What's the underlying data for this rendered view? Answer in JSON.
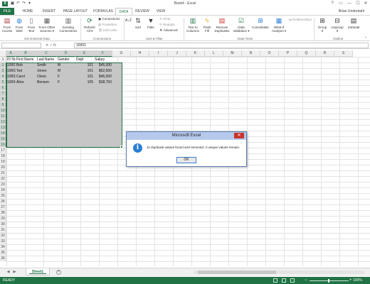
{
  "titlebar": {
    "app_title": "Book4 - Excel",
    "logo_text": "X",
    "help": "?",
    "ribbon_options": "▭",
    "minimize": "—",
    "maximize": "☐",
    "close": "✕"
  },
  "tabs": {
    "file": "FILE",
    "items": [
      "HOME",
      "INSERT",
      "PAGE LAYOUT",
      "FORMULAS",
      "DATA",
      "REVIEW",
      "VIEW"
    ],
    "active": "DATA",
    "user": "Brian Underdahl"
  },
  "ribbon": {
    "get_external_data": {
      "from_access": "From\nAccess",
      "from_web": "From\nWeb",
      "from_text": "From\nText",
      "from_other_sources": "From Other\nSources ▾",
      "existing_connections": "Existing\nConnections",
      "label": "Get External Data"
    },
    "connections": {
      "refresh_all": "Refresh\nAll ▾",
      "connections": "Connections",
      "properties": "Properties",
      "edit_links": "Edit Links",
      "label": "Connections"
    },
    "sort_filter": {
      "sort": "Sort",
      "filter": "Filter",
      "clear": "Clear",
      "reapply": "Reapply",
      "advanced": "Advanced",
      "label": "Sort & Filter"
    },
    "data_tools": {
      "text_to_columns": "Text to\nColumns",
      "flash_fill": "Flash\nFill",
      "remove_duplicates": "Remove\nDuplicates",
      "data_validation": "Data\nValidation ▾",
      "consolidate": "Consolidate",
      "what_if": "What-If\nAnalysis ▾",
      "relationships": "Relationships",
      "label": "Data Tools"
    },
    "outline": {
      "group": "Group\n▾",
      "ungroup": "Ungroup\n▾",
      "subtotal": "Subtotal",
      "label": "Outline"
    }
  },
  "formula_bar": {
    "fx": "✕  ✓  fx",
    "value": "10001"
  },
  "columns": [
    "A",
    "B",
    "C",
    "D",
    "E",
    "F",
    "G",
    "H",
    "I",
    "J",
    "K",
    "L",
    "M",
    "N",
    "O",
    "P",
    "Q",
    "R",
    "S"
  ],
  "rows": [
    "1",
    "2",
    "3",
    "4",
    "5",
    "6",
    "7",
    "8",
    "9",
    "10",
    "11",
    "12",
    "13",
    "14",
    "15",
    "16",
    "17",
    "18",
    "19",
    "20",
    "21",
    "22",
    "23",
    "24",
    "25",
    "26",
    "27",
    "28",
    "29",
    "30",
    "31",
    "32",
    "33",
    "34",
    "35",
    "36"
  ],
  "table": {
    "headers": [
      "ID No",
      "First Name",
      "Last Name",
      "Gender",
      "Dept",
      "Salary"
    ],
    "rows": [
      [
        "10001",
        "Bob",
        "Smith",
        "M",
        "101",
        "$45,000"
      ],
      [
        "10002",
        "Ted",
        "Jones",
        "M",
        "101",
        "$62,500"
      ],
      [
        "10003",
        "Carol",
        "Olson",
        "F",
        "101",
        "$46,500"
      ],
      [
        "10004",
        "Alice",
        "Bensen",
        "F",
        "105",
        "$38,750"
      ]
    ]
  },
  "sheets": {
    "tabs": [
      "Sheet1"
    ],
    "nav_prev": "◀",
    "nav_next": "▶",
    "add": "+"
  },
  "status": {
    "text": "READY",
    "zoom_minus": "−",
    "zoom_plus": "+",
    "zoom": "100%"
  },
  "dialog": {
    "title": "Microsoft Excel",
    "close": "✕",
    "icon": "i",
    "message": "11 duplicate values found and removed; 4 unique values remain.",
    "ok": "OK"
  },
  "colors": {
    "excel_green": "#217346",
    "selection_gray": "#c6c6c6",
    "dialog_title": "#b6c9ec",
    "close_red": "#c9342a"
  }
}
